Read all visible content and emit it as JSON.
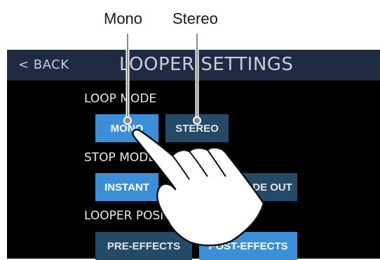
{
  "callouts": {
    "mono": "Mono",
    "stereo": "Stereo"
  },
  "header": {
    "back_label": "< BACK",
    "title": "LOOPER SETTINGS"
  },
  "sections": {
    "loop_mode": {
      "label": "LOOP MODE",
      "options": [
        "MONO",
        "STEREO"
      ],
      "selected": "MONO"
    },
    "stop_mode": {
      "label": "STOP MODE",
      "options": [
        "INSTANT",
        "FADE OUT"
      ],
      "selected": "INSTANT"
    },
    "looper_position": {
      "label": "LOOPER POSITION",
      "options": [
        "PRE-EFFECTS",
        "POST-EFFECTS"
      ],
      "selected": "POST-EFFECTS"
    }
  },
  "colors": {
    "title_bar": "#1f2a43",
    "selected_button": "#3b8fd6",
    "unselected_button": "#234a66",
    "screen_background": "#000000"
  },
  "icons": {
    "hand": "hand-pointer-icon"
  }
}
